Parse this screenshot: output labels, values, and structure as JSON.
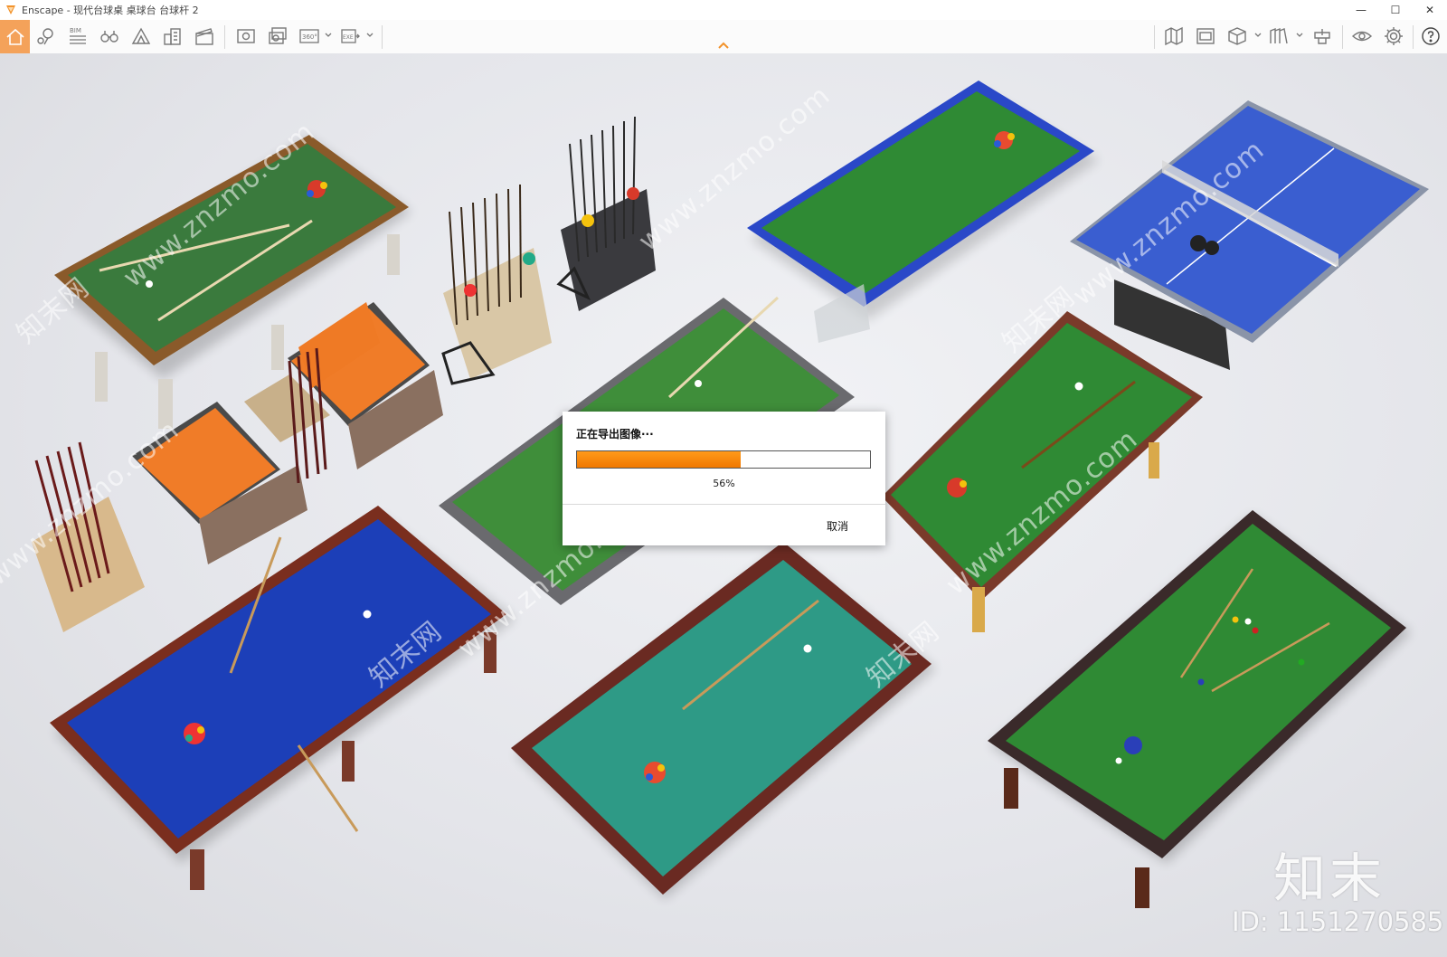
{
  "window": {
    "title": "Enscape - 现代台球桌 桌球台 台球杆 2",
    "minimize_glyph": "—",
    "maximize_glyph": "☐",
    "close_glyph": "✕",
    "app_icon": "enscape-logo-icon"
  },
  "toolbar": {
    "left_icons": [
      "home-icon",
      "location-pin-icon",
      "bim-icon",
      "binoculars-icon",
      "terrain-icon",
      "buildings-icon",
      "clapperboard-icon",
      "screenshot-icon",
      "batch-render-icon",
      "panorama-360-icon",
      "export-exe-icon"
    ],
    "bim_label": "BIM",
    "panorama_label": "360°",
    "exe_label": "EXE",
    "right_icons": [
      "map-icon",
      "asset-library-icon",
      "cube-icon",
      "materials-icon",
      "upload-icon",
      "visual-settings-icon",
      "settings-icon",
      "help-icon"
    ]
  },
  "dialog": {
    "title": "正在导出图像···",
    "progress": 0.56,
    "progress_label": "56%",
    "cancel_label": "取消"
  },
  "watermark": {
    "brand": "知末",
    "id_text": "ID: 1151270585",
    "tile_text": "www.znzmo.com",
    "tile_text_cn": "知末网"
  },
  "colors": {
    "accent_orange": "#f4a25a",
    "progress_orange": "#f58a0c",
    "felt_green": "#3a8c3e",
    "felt_blue": "#1c3fb0",
    "felt_teal": "#2f9a86"
  }
}
